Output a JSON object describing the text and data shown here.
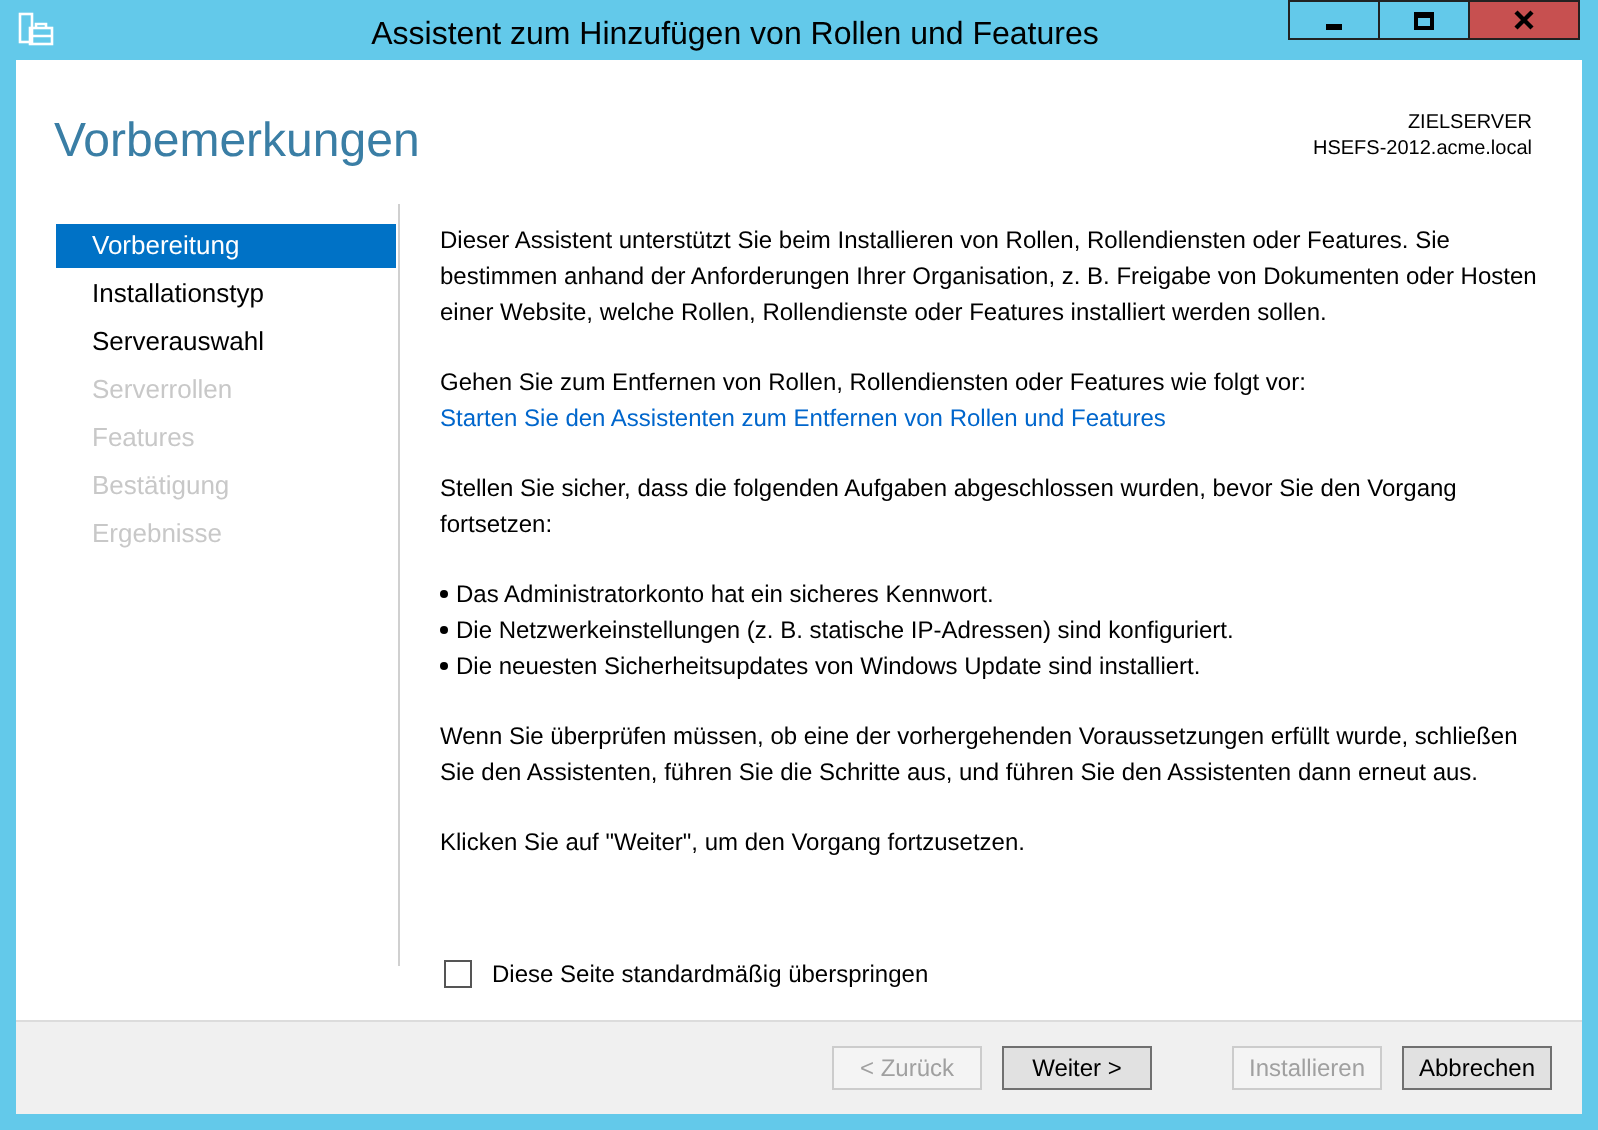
{
  "window": {
    "title": "Assistent zum Hinzufügen von Rollen und Features"
  },
  "header": {
    "title": "Vorbemerkungen",
    "server_label": "ZIELSERVER",
    "server_name": "HSEFS-2012.acme.local"
  },
  "steps": [
    {
      "label": "Vorbereitung",
      "selected": true,
      "disabled": false
    },
    {
      "label": "Installationstyp",
      "selected": false,
      "disabled": false
    },
    {
      "label": "Serverauswahl",
      "selected": false,
      "disabled": false
    },
    {
      "label": "Serverrollen",
      "selected": false,
      "disabled": true
    },
    {
      "label": "Features",
      "selected": false,
      "disabled": true
    },
    {
      "label": "Bestätigung",
      "selected": false,
      "disabled": true
    },
    {
      "label": "Ergebnisse",
      "selected": false,
      "disabled": true
    }
  ],
  "content": [
    {
      "kind": "text",
      "text": "Dieser Assistent unterstützt Sie beim Installieren von Rollen, Rollendiensten oder Features. Sie bestimmen anhand der Anforderungen Ihrer Organisation, z. B. Freigabe von Dokumenten oder Hosten einer Website, welche Rollen, Rollendienste oder Features installiert werden sollen."
    },
    {
      "kind": "text_link",
      "text": "Gehen Sie zum Entfernen von Rollen, Rollendiensten oder Features wie folgt vor:",
      "link": "Starten Sie den Assistenten zum Entfernen von Rollen und Features"
    },
    {
      "kind": "text",
      "text": "Stellen Sie sicher, dass die folgenden Aufgaben abgeschlossen wurden, bevor Sie den Vorgang fortsetzen:"
    },
    {
      "kind": "bullets",
      "items": [
        "Das Administratorkonto hat ein sicheres Kennwort.",
        "Die Netzwerkeinstellungen (z. B. statische IP-Adressen) sind konfiguriert.",
        "Die neuesten Sicherheitsupdates von Windows Update sind installiert."
      ]
    },
    {
      "kind": "text",
      "text": "Wenn Sie überprüfen müssen, ob eine der vorhergehenden Voraussetzungen erfüllt wurde, schließen Sie den Assistenten, führen Sie die Schritte aus, und führen Sie den Assistenten dann erneut aus."
    },
    {
      "kind": "text",
      "text": "Klicken Sie auf \"Weiter\", um den Vorgang fortzusetzen."
    }
  ],
  "skip_checkbox": {
    "label": "Diese Seite standardmäßig überspringen",
    "checked": false
  },
  "buttons": [
    {
      "label": "< Zurück",
      "disabled": true
    },
    {
      "label": "Weiter >",
      "disabled": false
    },
    {
      "label": "Installieren",
      "disabled": true
    },
    {
      "label": "Abbrechen",
      "disabled": false
    }
  ]
}
